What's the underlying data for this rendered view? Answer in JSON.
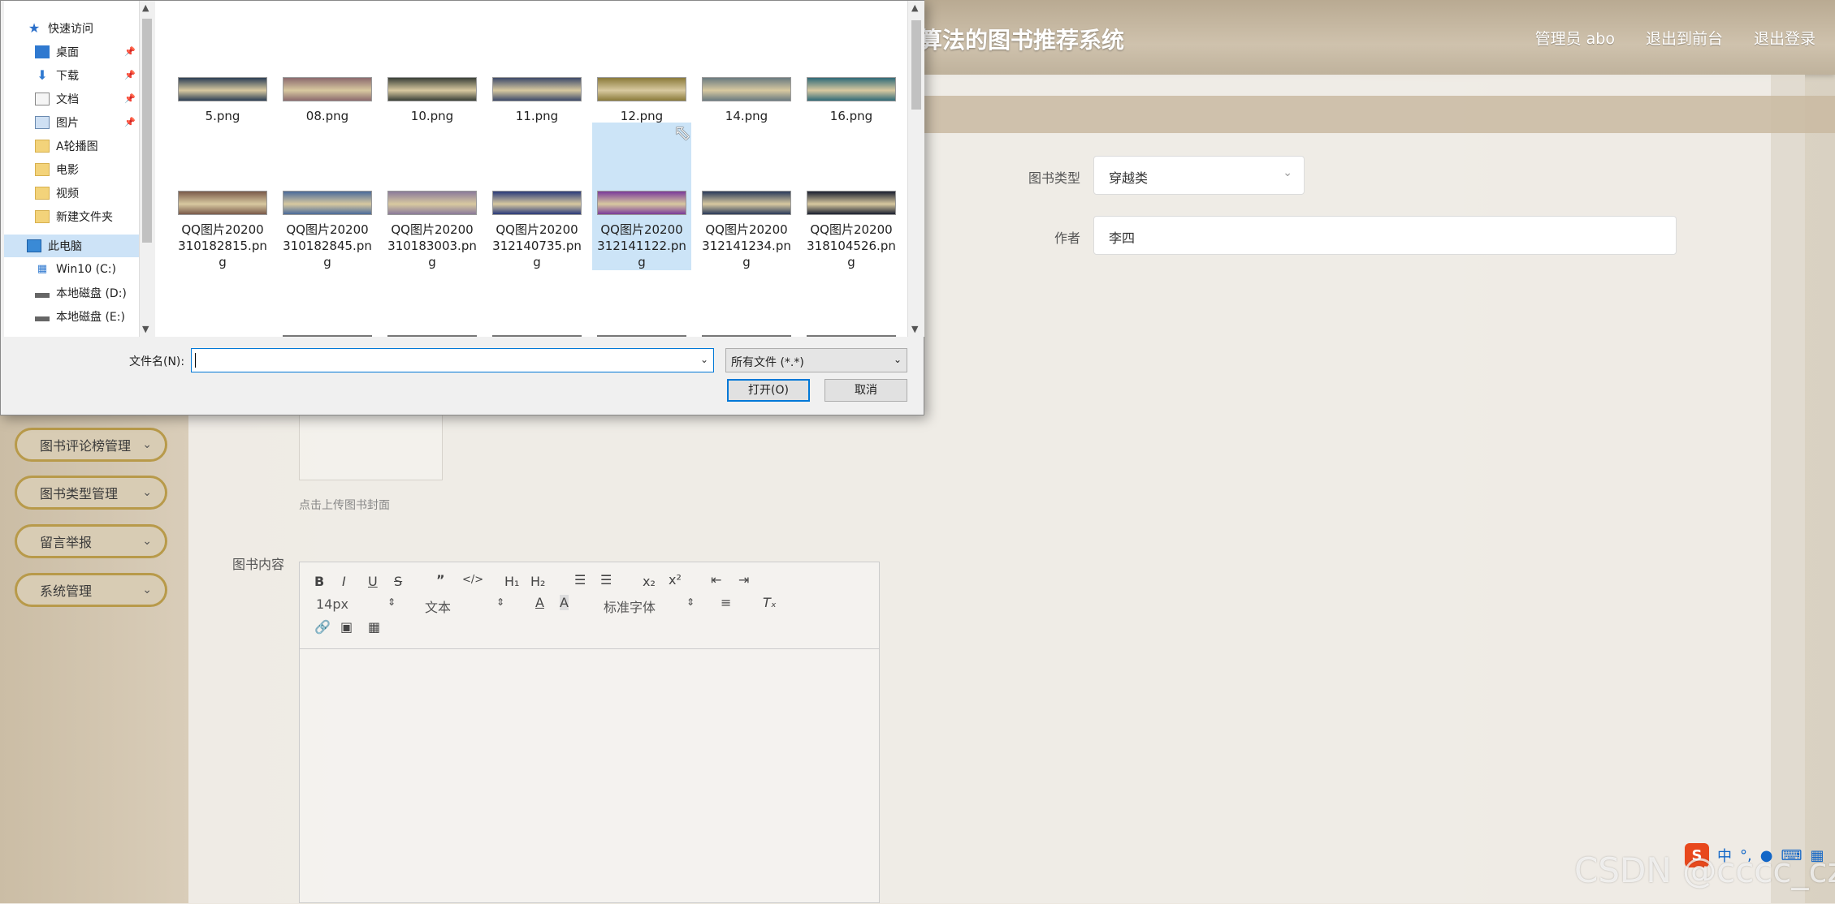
{
  "app": {
    "title": "算法的图书推荐系统",
    "header_links": [
      "管理员 abo",
      "退出到前台",
      "退出登录"
    ]
  },
  "sidebar": {
    "menu": [
      {
        "label": "图书评论榜管理"
      },
      {
        "label": "图书类型管理"
      },
      {
        "label": "留言举报"
      },
      {
        "label": "系统管理"
      }
    ]
  },
  "form": {
    "type_label": "图书类型",
    "type_value": "穿越类",
    "author_label": "作者",
    "author_value": "李四",
    "upload_hint": "点击上传图书封面",
    "content_label": "图书内容"
  },
  "editor": {
    "font_size": "14px",
    "header_select": "文本",
    "font_family": "标准字体",
    "buttons": [
      "bold-icon",
      "italic-icon",
      "underline-icon",
      "strike-icon",
      "quote-icon",
      "code-icon",
      "h1-icon",
      "h2-icon",
      "ordered-list-icon",
      "bullet-list-icon",
      "subscript-icon",
      "superscript-icon",
      "indent-decrease-icon",
      "indent-increase-icon",
      "text-color-icon",
      "background-color-icon",
      "align-icon",
      "clear-format-icon",
      "link-icon",
      "image-icon",
      "video-icon"
    ]
  },
  "dialog": {
    "nav": [
      {
        "label": "快速访问",
        "icon": "star-icon"
      },
      {
        "label": "桌面",
        "icon": "desktop-icon",
        "pinned": true
      },
      {
        "label": "下载",
        "icon": "download-icon",
        "pinned": true
      },
      {
        "label": "文档",
        "icon": "document-icon",
        "pinned": true
      },
      {
        "label": "图片",
        "icon": "picture-icon",
        "pinned": true
      },
      {
        "label": "A轮播图",
        "icon": "folder-icon"
      },
      {
        "label": "电影",
        "icon": "folder-icon"
      },
      {
        "label": "视频",
        "icon": "folder-icon"
      },
      {
        "label": "新建文件夹",
        "icon": "folder-icon"
      },
      {
        "label": "此电脑",
        "icon": "computer-icon",
        "selected": true
      },
      {
        "label": "Win10 (C:)",
        "icon": "windows-drive-icon"
      },
      {
        "label": "本地磁盘 (D:)",
        "icon": "drive-icon"
      },
      {
        "label": "本地磁盘 (E:)",
        "icon": "drive-icon"
      }
    ],
    "files_row1": [
      {
        "name": "5.png",
        "color": "#2c3e55"
      },
      {
        "name": "08.png",
        "color": "#8c6a6e"
      },
      {
        "name": "10.png",
        "color": "#3a4038"
      },
      {
        "name": "11.png",
        "color": "#3d4a6a"
      },
      {
        "name": "12.png",
        "color": "#8a7a3a"
      },
      {
        "name": "14.png",
        "color": "#6a7a80"
      },
      {
        "name": "16.png",
        "color": "#2f6a78"
      }
    ],
    "files_row2": [
      {
        "name": "QQ图片20200310182815.png",
        "color": "#7a5a4a"
      },
      {
        "name": "QQ图片20200310182845.png",
        "color": "#4a6a9a"
      },
      {
        "name": "QQ图片20200310183003.png",
        "color": "#8a7a9a"
      },
      {
        "name": "QQ图片20200312140735.png",
        "color": "#2a3a7a"
      },
      {
        "name": "QQ图片20200312141122.png",
        "color": "#7a3a9a",
        "selected": true
      },
      {
        "name": "QQ图片20200312141234.png",
        "color": "#2a3a5a"
      },
      {
        "name": "QQ图片20200318104526.png",
        "color": "#1a2030"
      }
    ],
    "filename_label": "文件名(N):",
    "filename_value": "",
    "filter": "所有文件 (*.*)",
    "open_label": "打开(O)",
    "cancel_label": "取消"
  },
  "ime": {
    "lang": "中"
  },
  "watermark": "CSDN @cccc_cz"
}
